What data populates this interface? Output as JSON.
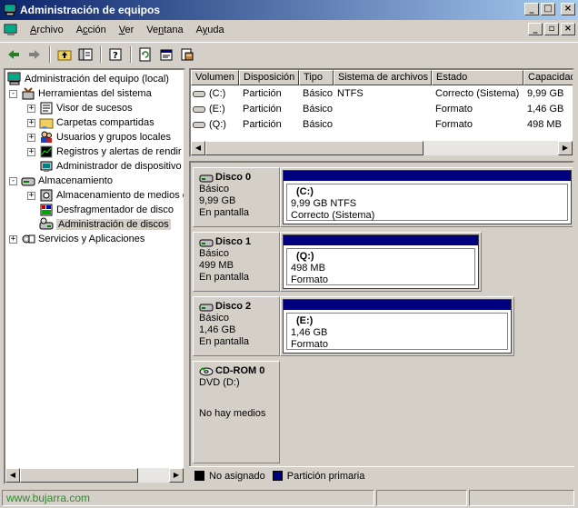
{
  "window": {
    "title": "Administración de equipos",
    "buttons": [
      "_",
      "□",
      "×"
    ]
  },
  "menubar": {
    "items": [
      {
        "label": "Archivo",
        "underline": "A"
      },
      {
        "label": "Acción",
        "underline": "c"
      },
      {
        "label": "Ver",
        "underline": "V"
      },
      {
        "label": "Ventana",
        "underline": "n"
      },
      {
        "label": "Ayuda",
        "underline": "y"
      }
    ],
    "child_buttons": [
      "_",
      "▫",
      "×"
    ]
  },
  "toolbar": {
    "icons": [
      "back-arrow-icon",
      "forward-arrow-icon",
      "up-folder-icon",
      "show-hide-tree-icon",
      "help-icon",
      "refresh-icon",
      "properties-icon",
      "export-icon"
    ]
  },
  "tree": {
    "items": [
      {
        "label": "Administración del equipo (local)",
        "level": 0,
        "expander": "",
        "icon": "computer-icon"
      },
      {
        "label": "Herramientas del sistema",
        "level": 1,
        "expander": "-",
        "icon": "tools-icon"
      },
      {
        "label": "Visor de sucesos",
        "level": 2,
        "expander": "+",
        "icon": "event-viewer-icon"
      },
      {
        "label": "Carpetas compartidas",
        "level": 2,
        "expander": "+",
        "icon": "shared-folder-icon"
      },
      {
        "label": "Usuarios y grupos locales",
        "level": 2,
        "expander": "+",
        "icon": "users-icon"
      },
      {
        "label": "Registros y alertas de rendir",
        "level": 2,
        "expander": "+",
        "icon": "performance-icon"
      },
      {
        "label": "Administrador de dispositivo",
        "level": 2,
        "expander": "",
        "icon": "device-manager-icon"
      },
      {
        "label": "Almacenamiento",
        "level": 1,
        "expander": "-",
        "icon": "storage-icon"
      },
      {
        "label": "Almacenamiento de medios e",
        "level": 2,
        "expander": "+",
        "icon": "removable-storage-icon"
      },
      {
        "label": "Desfragmentador de disco",
        "level": 2,
        "expander": "",
        "icon": "defrag-icon"
      },
      {
        "label": "Administración de discos",
        "level": 2,
        "expander": "",
        "icon": "disk-management-icon",
        "selected": true
      },
      {
        "label": "Servicios y Aplicaciones",
        "level": 1,
        "expander": "+",
        "icon": "services-icon"
      }
    ]
  },
  "volumes": {
    "columns": [
      "Volumen",
      "Disposición",
      "Tipo",
      "Sistema de archivos",
      "Estado",
      "Capacidad"
    ],
    "rows": [
      [
        "(C:)",
        "Partición",
        "Básico",
        "NTFS",
        "Correcto (Sistema)",
        "9,99 GB"
      ],
      [
        "(E:)",
        "Partición",
        "Básico",
        "",
        "Formato",
        "1,46 GB"
      ],
      [
        "(Q:)",
        "Partición",
        "Básico",
        "",
        "Formato",
        "498 MB"
      ]
    ]
  },
  "disks": [
    {
      "name": "Disco 0",
      "type": "Básico",
      "size": "9,99 GB",
      "state": "En pantalla",
      "partition": {
        "label": "(C:)",
        "line1": "9,99 GB NTFS",
        "line2": "Correcto (Sistema)"
      }
    },
    {
      "name": "Disco 1",
      "type": "Básico",
      "size": "499 MB",
      "state": "En pantalla",
      "partition": {
        "label": "(Q:)",
        "line1": "498 MB",
        "line2": "Formato"
      }
    },
    {
      "name": "Disco 2",
      "type": "Básico",
      "size": "1,46 GB",
      "state": "En pantalla",
      "partition": {
        "label": "(E:)",
        "line1": "1,46 GB",
        "line2": "Formato"
      }
    },
    {
      "name": "CD-ROM 0",
      "type": "DVD (D:)",
      "size": "",
      "state": "No hay medios",
      "partition": null
    }
  ],
  "legend": [
    {
      "label": "No asignado",
      "color": "#000000"
    },
    {
      "label": "Partición primaria",
      "color": "#00007f"
    }
  ],
  "statusbar": {
    "text": "www.bujarra.com"
  }
}
